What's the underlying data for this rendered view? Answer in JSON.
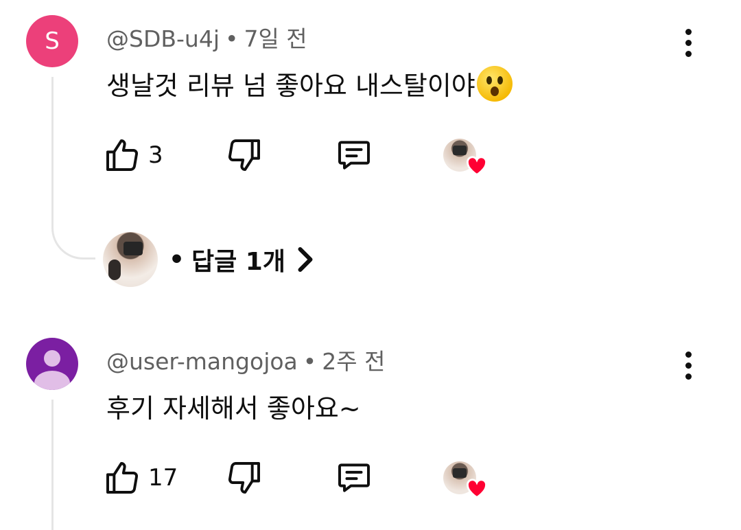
{
  "comments": [
    {
      "avatar_letter": "S",
      "avatar_color": "#ec407a",
      "author": "@SDB-u4j",
      "separator": "•",
      "time": "7일 전",
      "text": "생날것 리뷰 넘 좋아요 내스탈이야",
      "emoji_icon": "hushed-face-emoji",
      "likes": "3",
      "replies": {
        "separator": "•",
        "label": "답글 1개"
      }
    },
    {
      "avatar_color": "#7b1fa2",
      "author": "@user-mangojoa",
      "separator": "•",
      "time": "2주 전",
      "text": "후기 자세해서 좋아요~",
      "likes": "17"
    }
  ],
  "colors": {
    "heart": "#ff0033",
    "meta_text": "#606060",
    "thread_line": "#e5e5e5"
  },
  "icons": [
    "thumbs-up-icon",
    "thumbs-down-icon",
    "reply-icon",
    "heart-icon",
    "more-vert-icon",
    "chevron-right-icon",
    "person-icon"
  ]
}
